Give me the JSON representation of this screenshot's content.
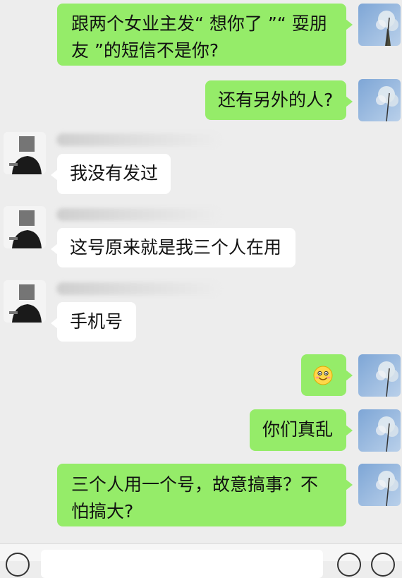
{
  "chat": {
    "messages": [
      {
        "side": "right",
        "text": "跟两个女业主发“ 想你了 ”“ 耍朋友 ”的短信不是你?"
      },
      {
        "side": "right",
        "text": "还有另外的人?"
      },
      {
        "side": "left",
        "text": "我没有发过"
      },
      {
        "side": "left",
        "text": "这号原来就是我三个人在用"
      },
      {
        "side": "left",
        "text": "手机号"
      },
      {
        "side": "right",
        "emoji": "smiling-face-emoji"
      },
      {
        "side": "right",
        "text": "你们真乱"
      },
      {
        "side": "right",
        "text": "三个人用一个号，故意搞事？不怕搞大?"
      }
    ]
  },
  "colors": {
    "background": "#ededed",
    "sent_bubble": "#95ec69",
    "received_bubble": "#ffffff"
  },
  "icons": {
    "voice": "voice-icon",
    "emoji": "emoji-icon",
    "more": "plus-icon"
  }
}
